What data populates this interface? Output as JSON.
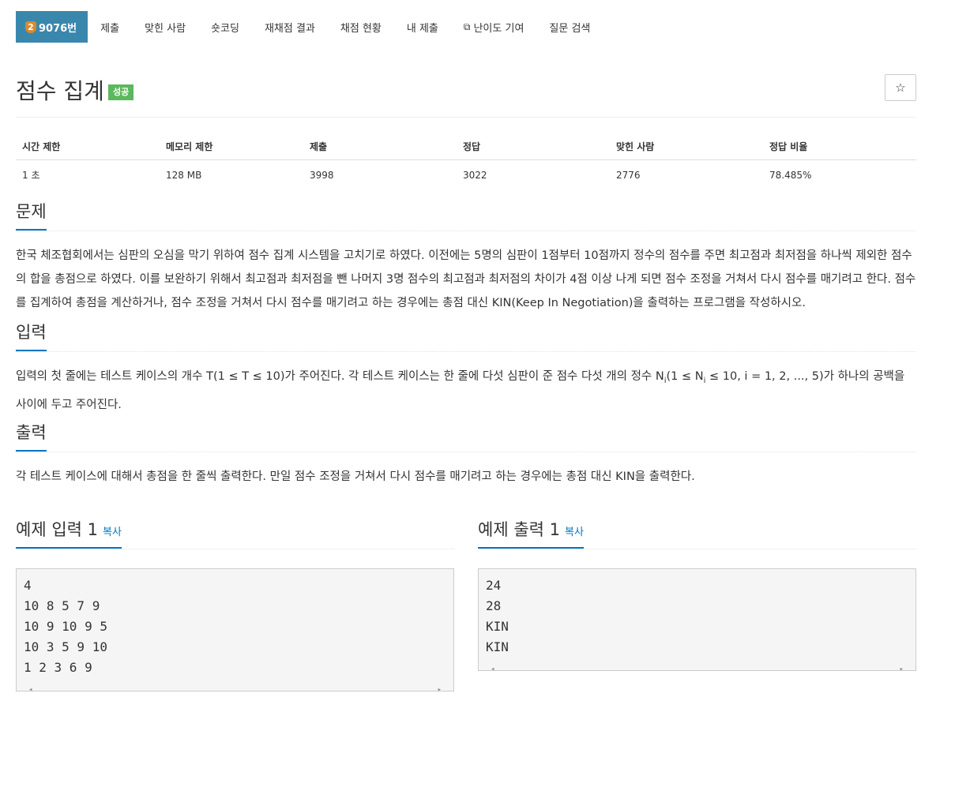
{
  "nav": {
    "problem_badge": "2",
    "problem_id": "9076번",
    "items": [
      "제출",
      "맞힌 사람",
      "숏코딩",
      "재채점 결과",
      "채점 현황",
      "내 제출",
      "난이도 기여",
      "질문 검색"
    ]
  },
  "header": {
    "title": "점수 집계",
    "status": "성공",
    "star": "☆"
  },
  "info": {
    "headers": [
      "시간 제한",
      "메모리 제한",
      "제출",
      "정답",
      "맞힌 사람",
      "정답 비율"
    ],
    "values": [
      "1 초",
      "128 MB",
      "3998",
      "3022",
      "2776",
      "78.485%"
    ]
  },
  "problem": {
    "title": "문제",
    "text": "한국 체조협회에서는 심판의 오심을 막기 위하여 점수 집계 시스템을 고치기로 하였다. 이전에는 5명의 심판이 1점부터 10점까지 정수의 점수를 주면 최고점과 최저점을 하나씩 제외한 점수의 합을 총점으로 하였다. 이를 보완하기 위해서 최고점과 최저점을 뺀 나머지 3명 점수의 최고점과 최저점의 차이가 4점 이상 나게 되면 점수 조정을 거쳐서 다시 점수를 매기려고 한다. 점수를 집계하여 총점을 계산하거나, 점수 조정을 거쳐서 다시 점수를 매기려고 하는 경우에는 총점 대신 KIN(Keep In Negotiation)을 출력하는 프로그램을 작성하시오."
  },
  "input": {
    "title": "입력",
    "text_a": "입력의 첫 줄에는 테스트 케이스의 개수 T(1 ≤ T ≤ 10)가 주어진다. 각 테스트 케이스는 한 줄에 다섯 심판이 준 점수 다섯 개의 정수 N",
    "sub1": "i",
    "text_b": "(1 ≤ N",
    "sub2": "i",
    "text_c": " ≤ 10, i = 1, 2, ..., 5)가 하나의 공백을 사이에 두고 주어진다."
  },
  "output": {
    "title": "출력",
    "text": "각 테스트 케이스에 대해서 총점을 한 줄씩 출력한다. 만일 점수 조정을 거쳐서 다시 점수를 매기려고 하는 경우에는 총점 대신 KIN을 출력한다."
  },
  "sample_input": {
    "title": "예제 입력 1",
    "copy": "복사",
    "lines": [
      "4",
      "10 8 5 7 9",
      "10 9 10 9 5",
      "10 3 5 9 10",
      "1 2 3 6 9"
    ]
  },
  "sample_output": {
    "title": "예제 출력 1",
    "copy": "복사",
    "lines": [
      "24",
      "28",
      "KIN",
      "KIN"
    ]
  },
  "scroll": {
    "left": "◂",
    "right": "▸"
  }
}
